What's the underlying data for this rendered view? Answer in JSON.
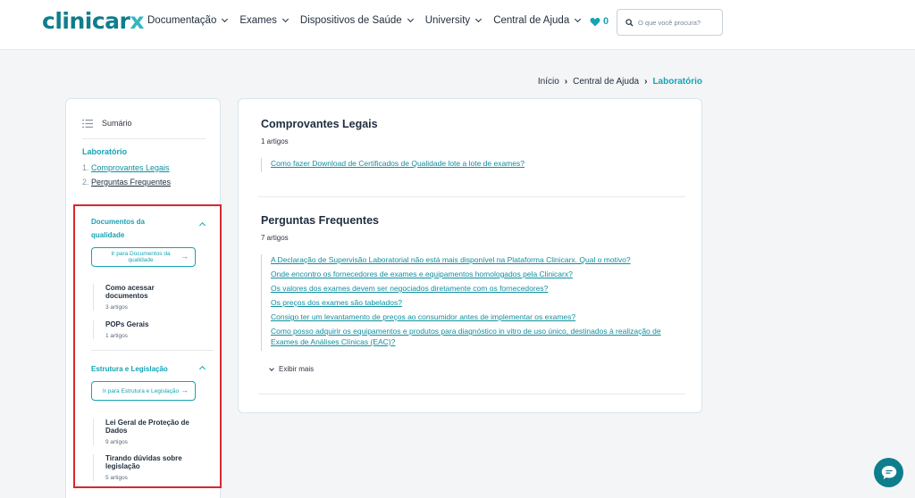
{
  "header": {
    "logo_main": "clinicar",
    "logo_x": "x",
    "nav": [
      {
        "label": "Documentação"
      },
      {
        "label": "Exames"
      },
      {
        "label": "Dispositivos de Saúde"
      },
      {
        "label": "University"
      },
      {
        "label": "Central de Ajuda"
      }
    ],
    "favorites_count": "0",
    "search_placeholder": "O que você procura?"
  },
  "breadcrumb": {
    "items": [
      "Início",
      "Central de Ajuda"
    ],
    "current": "Laboratório"
  },
  "sidebar": {
    "summary_label": "Sumário",
    "category": "Laboratório",
    "sections": [
      {
        "num": "1.",
        "label": "Comprovantes Legais"
      },
      {
        "num": "2.",
        "label": "Perguntas Frequentes"
      }
    ],
    "groups": [
      {
        "title": "Documentos da qualidade",
        "button": "Ir para Documentos da qualidade",
        "items": [
          {
            "title": "Como acessar documentos",
            "count": "3 artigos"
          },
          {
            "title": "POPs Gerais",
            "count": "1 artigos"
          }
        ]
      },
      {
        "title": "Estrutura e Legislação",
        "button": "Ir para Estrutura e Legislação",
        "items": [
          {
            "title": "Lei Geral de Proteção de Dados",
            "count": "9 artigos"
          },
          {
            "title": "Tirando dúvidas sobre legislação",
            "count": "5 artigos"
          }
        ]
      }
    ]
  },
  "main": {
    "sections": [
      {
        "title": "Comprovantes Legais",
        "count": "1 artigos",
        "links": [
          "Como fazer Download de Certificados de Qualidade lote a lote de exames?"
        ]
      },
      {
        "title": "Perguntas Frequentes",
        "count": "7 artigos",
        "links": [
          "A Declaração de Supervisão Laboratorial não está mais disponível na Plataforma Clinicarx. Qual o motivo?",
          "Onde encontro os fornecedores de exames e equipamentos homologados pela Clinicarx?",
          "Os valores dos exames devem ser negociados diretamente com os fornecedores?",
          "Os preços dos exames são tabelados?",
          "Consigo ter um levantamento de preços ao consumidor antes de implementar os exames?",
          "Como posso adquirir os equipamentos e produtos para diagnóstico in vitro de uso único, destinados à realização de Exames de Análises Clínicas (EAC)?"
        ],
        "show_more": "Exibir mais"
      }
    ]
  },
  "colors": {
    "brand": "#0e7e8c",
    "accent": "#16a3b4",
    "highlight": "#d7282f"
  }
}
